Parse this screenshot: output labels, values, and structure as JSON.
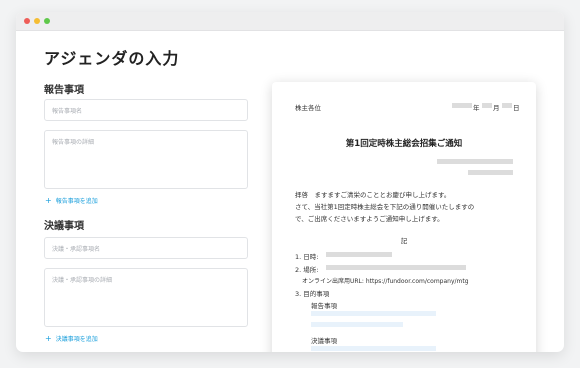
{
  "page": {
    "title": "アジェンダの入力"
  },
  "report_section": {
    "heading": "報告事項",
    "name_placeholder": "報告事項名",
    "detail_placeholder": "報告事項の詳細",
    "add_label": "報告事項を追加"
  },
  "resolution_section": {
    "heading": "決議事項",
    "name_placeholder": "決議・承認事項名",
    "detail_placeholder": "決議・承認事項の詳細",
    "add_label": "決議事項を追加"
  },
  "document": {
    "addressee": "株主各位",
    "date_year": "年",
    "date_month": "月",
    "date_day": "日",
    "title": "第1回定時株主総会招集ご通知",
    "greeting_1": "拝啓　ますますご清栄のこととお慶び申し上げます。",
    "greeting_2": "さて、当社第1回定時株主総会を下記の通り開催いたしますの",
    "greeting_3": "で、ご出席くださいますようご通知申し上げます。",
    "ki": "記",
    "item1_label": "1. 日時:",
    "item2_label": "2. 場所:",
    "online_url_line": "オンライン出席用URL: https://fundoor.com/company/mtg",
    "item3_label": "3. 目的事項",
    "reports_label": "報告事項",
    "resolutions_label": "決議事項"
  },
  "colors": {
    "accent": "#1a9fdc",
    "placeholder_bar": "#dcdcdc",
    "highlight_bar": "#e8f2fb"
  }
}
